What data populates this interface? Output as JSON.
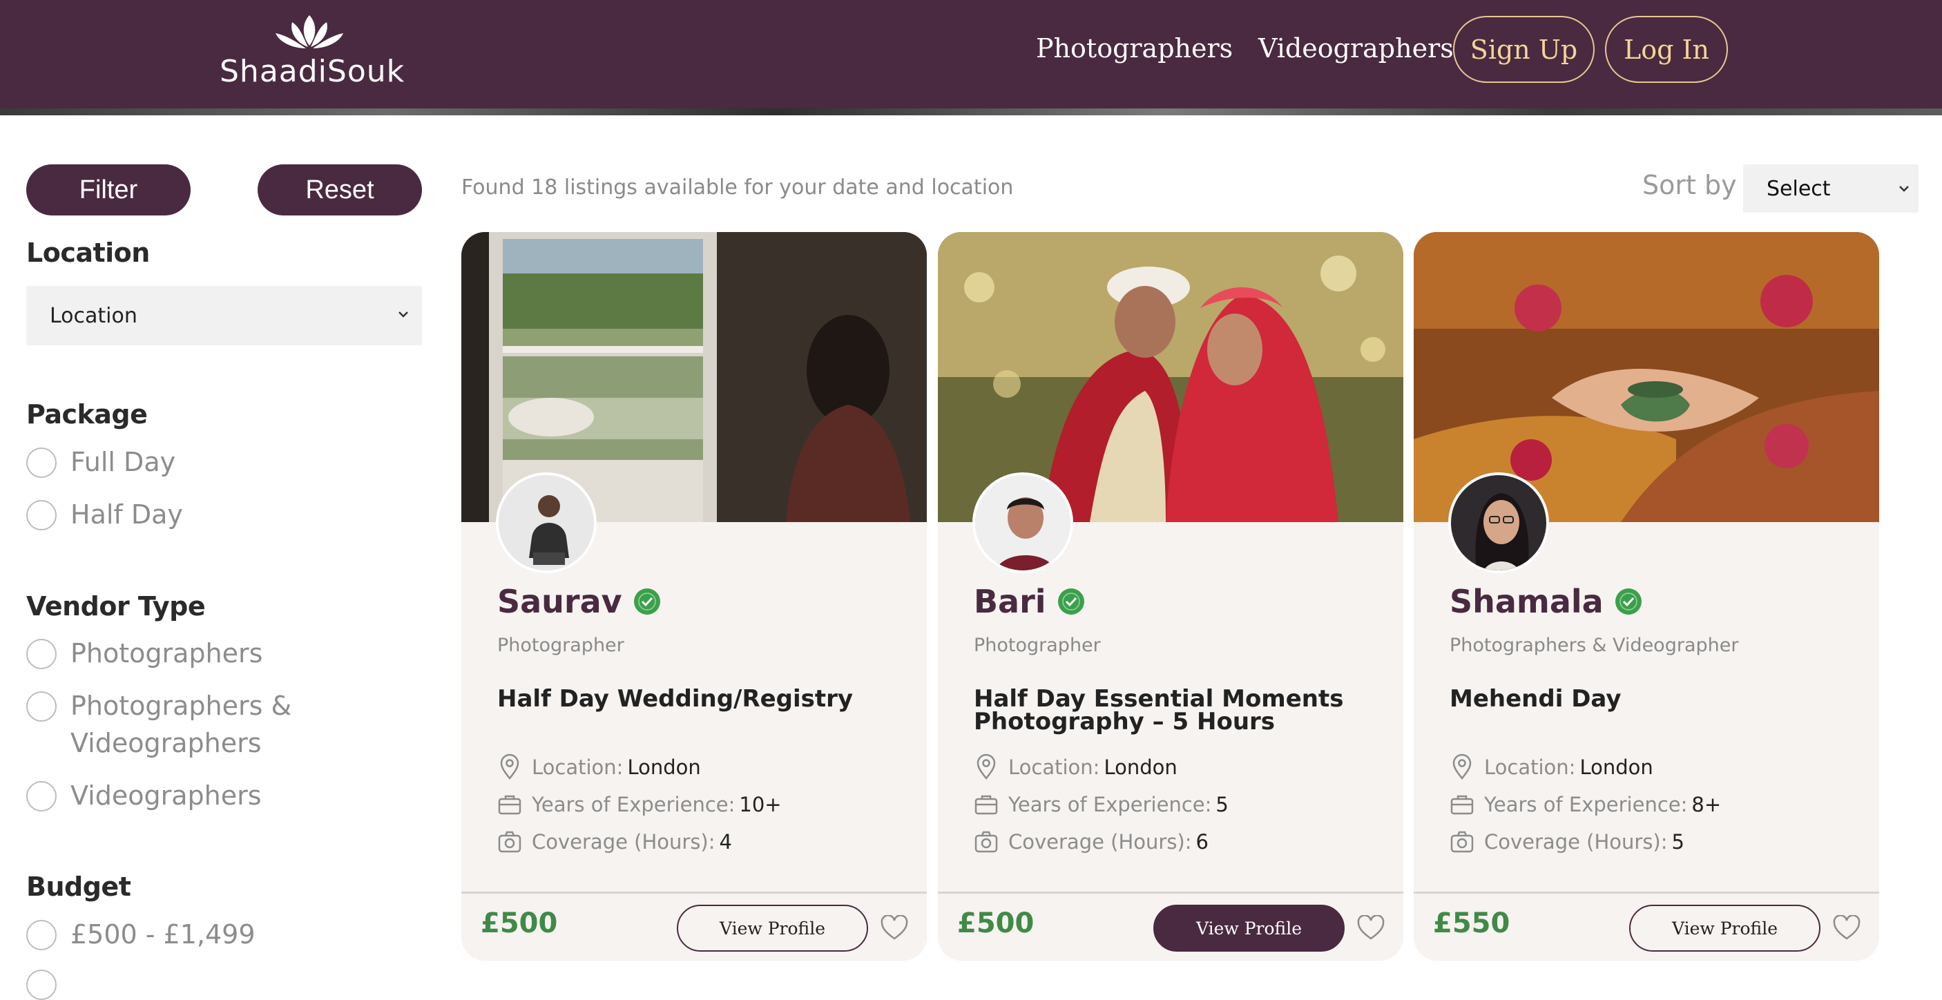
{
  "header": {
    "logo_text": "ShaadiSouk",
    "nav": {
      "photographers": "Photographers",
      "videographers": "Videographers"
    },
    "sign_up": "Sign Up",
    "log_in": "Log In"
  },
  "sidebar": {
    "filter_label": "Filter",
    "reset_label": "Reset",
    "location_heading": "Location",
    "location_select": "Location",
    "package_heading": "Package",
    "packages": [
      "Full Day",
      "Half Day"
    ],
    "vendor_heading": "Vendor Type",
    "vendors": [
      "Photographers",
      "Photographers &",
      "Videographers",
      "Videographers"
    ],
    "budget_heading": "Budget",
    "budgets": [
      "£500 - £1,499"
    ]
  },
  "results": {
    "found_text": "Found 18 listings available for your date and location",
    "sort_label": "Sort by",
    "sort_value": "Select"
  },
  "labels": {
    "location": "Location:",
    "experience": "Years of Experience:",
    "coverage": "Coverage (Hours):"
  },
  "cards": [
    {
      "name": "Saurav",
      "role": "Photographer",
      "title": "Half Day Wedding/Registry",
      "location": "London",
      "experience": "10+",
      "coverage": "4",
      "price": "£500",
      "button": "View Profile"
    },
    {
      "name": "Bari",
      "role": "Photographer",
      "title": "Half Day Essential Moments Photography – 5 Hours",
      "location": "London",
      "experience": "5",
      "coverage": "6",
      "price": "£500",
      "button": "View Profile"
    },
    {
      "name": "Shamala",
      "role": "Photographers & Videographer",
      "title": "Mehendi Day",
      "location": "London",
      "experience": "8+",
      "coverage": "5",
      "price": "£550",
      "button": "View Profile"
    }
  ],
  "colors": {
    "brand": "#4a2a40",
    "accent_gold": "#f3d598",
    "price_green": "#3f8a47",
    "verified_green": "#3aa14a",
    "card_bg": "#f6f3f0"
  },
  "icons": [
    "lotus-logo-icon",
    "chevron-down-icon",
    "verified-badge-icon",
    "location-pin-icon",
    "briefcase-icon",
    "camera-icon",
    "heart-icon"
  ]
}
